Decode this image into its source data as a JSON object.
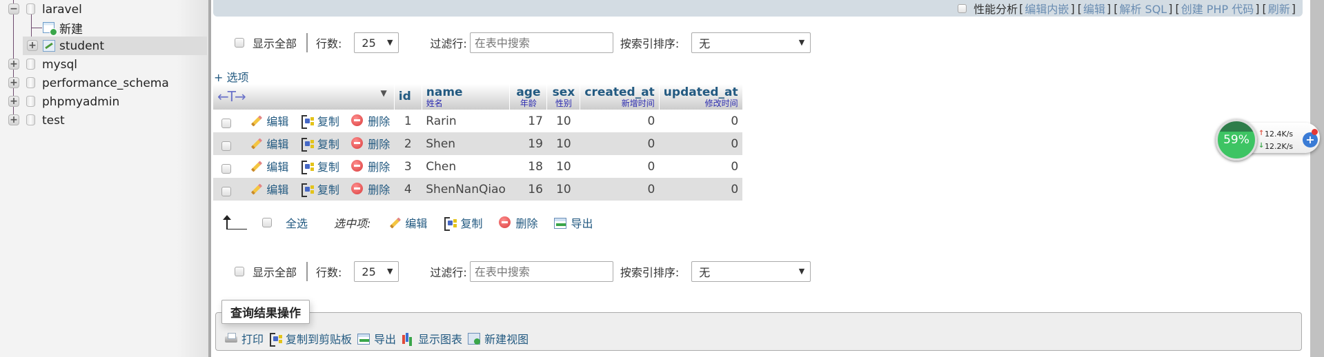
{
  "sidebar": {
    "databases": [
      {
        "name": "laravel",
        "expanded": true,
        "children": [
          {
            "label": "新建",
            "type": "new"
          },
          {
            "label": "student",
            "type": "table",
            "selected": true
          }
        ]
      },
      {
        "name": "mysql",
        "expanded": false
      },
      {
        "name": "performance_schema",
        "expanded": false
      },
      {
        "name": "phpmyadmin",
        "expanded": false
      },
      {
        "name": "test",
        "expanded": false
      }
    ]
  },
  "topbar": {
    "profiling_label": "性能分析",
    "links": [
      "编辑内嵌",
      " 编辑 ",
      " 解析 SQL ",
      " 创建 PHP 代码 ",
      " 刷新"
    ]
  },
  "filter": {
    "show_all_label": "显示全部",
    "rows_label": "行数:",
    "rows_value": "25",
    "filter_label": "过滤行:",
    "filter_placeholder": "在表中搜索",
    "sort_label": "按索引排序:",
    "sort_value": "无"
  },
  "options_link": "+ 选项",
  "table": {
    "columns": [
      {
        "name": "id",
        "comment": ""
      },
      {
        "name": "name",
        "comment": "姓名"
      },
      {
        "name": "age",
        "comment": "年龄"
      },
      {
        "name": "sex",
        "comment": "性别"
      },
      {
        "name": "created_at",
        "comment": "新增时间"
      },
      {
        "name": "updated_at",
        "comment": "修改时间"
      }
    ],
    "row_actions": {
      "edit": "编辑",
      "copy": "复制",
      "delete": "删除"
    },
    "rows": [
      {
        "id": "1",
        "name": "Rarin",
        "age": "17",
        "sex": "10",
        "created_at": "0",
        "updated_at": "0"
      },
      {
        "id": "2",
        "name": "Shen",
        "age": "19",
        "sex": "10",
        "created_at": "0",
        "updated_at": "0"
      },
      {
        "id": "3",
        "name": "Chen",
        "age": "18",
        "sex": "10",
        "created_at": "0",
        "updated_at": "0"
      },
      {
        "id": "4",
        "name": "ShenNanQiao",
        "age": "16",
        "sex": "10",
        "created_at": "0",
        "updated_at": "0"
      }
    ]
  },
  "bulk": {
    "select_all": "全选",
    "with_selected": "选中项:",
    "edit": "编辑",
    "copy": "复制",
    "delete": "删除",
    "export": "导出"
  },
  "query_ops": {
    "legend": "查询结果操作",
    "actions": {
      "print": "打印",
      "copy_clipboard": "复制到剪贴板",
      "export": "导出",
      "chart": "显示图表",
      "create_view": "新建视图"
    }
  },
  "net_widget": {
    "percent": "59%",
    "upload": "12.4K/s",
    "download": "12.2K/s",
    "upload_color": "#e05a4a",
    "download_color": "#3aa64a"
  }
}
